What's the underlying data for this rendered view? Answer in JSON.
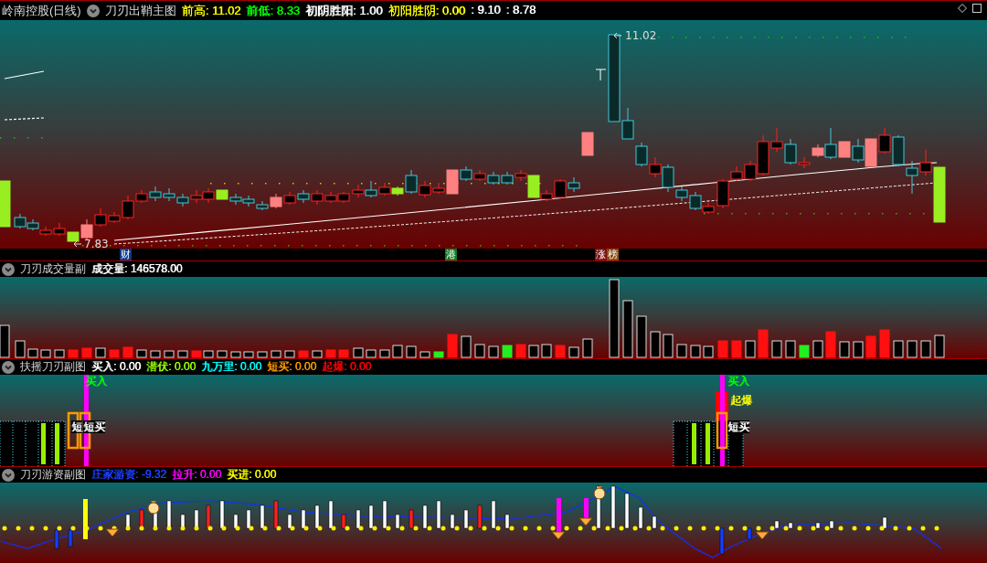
{
  "stock": {
    "name": "岭南控股(日线)"
  },
  "main_panel": {
    "indicator": "刀刃出鞘主图",
    "values": [
      {
        "text": "前高: 11.02",
        "color": "#ffff00"
      },
      {
        "text": "前低: 8.33",
        "color": "#00ff00"
      },
      {
        "text": "初阴胜阳: 1.00",
        "color": "#ffffff"
      },
      {
        "text": "初阳胜阴: 0.00",
        "color": "#ffff00"
      },
      {
        "text": ": 9.10",
        "color": "#ffffff"
      },
      {
        "text": ": 8.78",
        "color": "#ffffff"
      }
    ],
    "high_label": "11.02",
    "low_label": "7.83",
    "markers": [
      {
        "text": "财",
        "color": "#0a3a8a"
      },
      {
        "text": "港",
        "color": "#0a7a20"
      },
      {
        "text": "涨",
        "color": "#7a1010"
      },
      {
        "text": "榜",
        "color": "#8a4a10"
      }
    ]
  },
  "volume_panel": {
    "indicator": "刀刃成交量副",
    "values": [
      {
        "text": "成交量: 146578.00",
        "color": "#ffffff"
      }
    ]
  },
  "signal_panel": {
    "indicator": "扶摇刀刃副图",
    "values": [
      {
        "text": "买入: 0.00",
        "kind": "buy"
      },
      {
        "text": "潜伏: 0.00",
        "kind": "lurk"
      },
      {
        "text": "九万里: 0.00",
        "kind": "soar"
      },
      {
        "text": "短买: 0.00",
        "kind": "short"
      },
      {
        "text": "起爆: 0.00",
        "kind": "burst"
      }
    ],
    "signals": [
      {
        "text": "买入",
        "kind": "buy"
      },
      {
        "text": "短",
        "kind": "short"
      },
      {
        "text": "短买",
        "kind": "short"
      },
      {
        "text": "买入",
        "kind": "buy"
      },
      {
        "text": "起爆",
        "kind": "burst"
      },
      {
        "text": "短买",
        "kind": "short"
      }
    ]
  },
  "capital_panel": {
    "indicator": "刀刃游资副图",
    "values": [
      {
        "text": "庄家游资: -9.32",
        "color": "#2040ff"
      },
      {
        "text": "拉升: 0.00",
        "color": "#ff00ff"
      },
      {
        "text": "买进: 0.00",
        "color": "#ffff00"
      }
    ]
  }
}
